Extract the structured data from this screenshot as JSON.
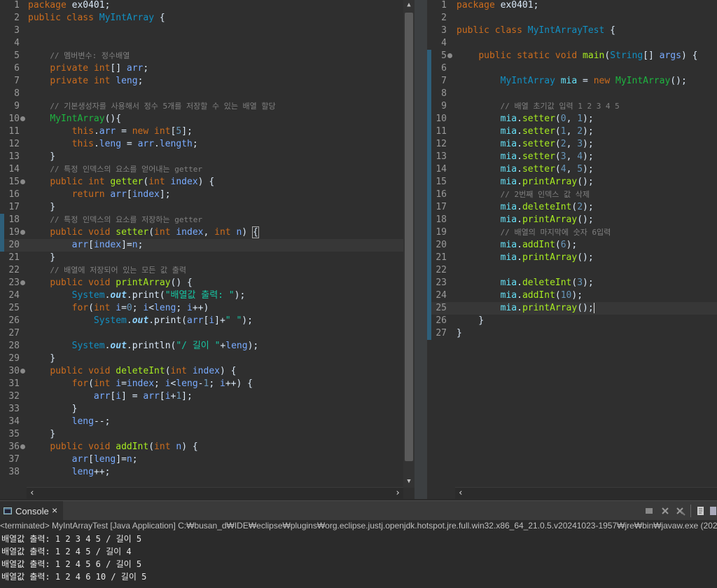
{
  "left_editor": {
    "lines": [
      {
        "n": "1",
        "html": "<span class=\"k\">package</span> ex0401;"
      },
      {
        "n": "2",
        "html": "<span class=\"k\">public</span> <span class=\"k\">class</span> <span class=\"t\">MyIntArray</span> {"
      },
      {
        "n": "3",
        "html": ""
      },
      {
        "n": "4",
        "html": ""
      },
      {
        "n": "5",
        "html": "    <span class=\"c\">// 멤버변수: 정수배열</span>"
      },
      {
        "n": "6",
        "html": "    <span class=\"k\">private</span> <span class=\"k\">int</span>[] <span class=\"v\">arr</span>;"
      },
      {
        "n": "7",
        "html": "    <span class=\"k\">private</span> <span class=\"k\">int</span> <span class=\"v\">leng</span>;"
      },
      {
        "n": "8",
        "html": ""
      },
      {
        "n": "9",
        "html": "    <span class=\"c\">// 기본생성자를 사용해서 정수 5개를 저장할 수 있는 배열 할당</span>"
      },
      {
        "n": "10",
        "fold": true,
        "html": "    <span class=\"f\">MyIntArray</span>(){"
      },
      {
        "n": "11",
        "html": "        <span class=\"k\">this</span>.<span class=\"v\">arr</span> = <span class=\"k\">new</span> <span class=\"k\">int</span>[<span class=\"n\">5</span>];"
      },
      {
        "n": "12",
        "html": "        <span class=\"k\">this</span>.<span class=\"v\">leng</span> = <span class=\"v\">arr</span>.<span class=\"v\">length</span>;"
      },
      {
        "n": "13",
        "html": "    }"
      },
      {
        "n": "14",
        "html": "    <span class=\"c\">// 특정 인덱스의 요소를 얻어내는 getter</span>"
      },
      {
        "n": "15",
        "fold": true,
        "html": "    <span class=\"k\">public</span> <span class=\"k\">int</span> <span class=\"f2\">getter</span>(<span class=\"k\">int</span> <span class=\"v\">index</span>) {"
      },
      {
        "n": "16",
        "html": "        <span class=\"k\">return</span> <span class=\"v\">arr</span>[<span class=\"v\">index</span>];"
      },
      {
        "n": "17",
        "html": "    }"
      },
      {
        "n": "18",
        "html": "    <span class=\"c\">// 특정 인덱스의 요소를 저장하는 getter</span>"
      },
      {
        "n": "19",
        "fold": true,
        "html": "    <span class=\"k\">public</span> <span class=\"k\">void</span> <span class=\"f2\">setter</span>(<span class=\"k\">int</span> <span class=\"v\">index</span>, <span class=\"k\">int</span> <span class=\"v\">n</span>) <span style=\"outline:1px solid #aaa\">{</span>"
      },
      {
        "n": "20",
        "html": "        <span class=\"v\">arr</span>[<span class=\"v\">index</span>]=<span class=\"v\">n</span>;"
      },
      {
        "n": "21",
        "html": "    }"
      },
      {
        "n": "22",
        "html": "    <span class=\"c\">// 배열에 저장되어 있는 모든 값 출력</span>"
      },
      {
        "n": "23",
        "fold": true,
        "html": "    <span class=\"k\">public</span> <span class=\"k\">void</span> <span class=\"f2\">printArray</span>() {"
      },
      {
        "n": "24",
        "html": "        <span class=\"t\">System</span>.<span class=\"st\">out</span>.print(<span class=\"s\">\"배열값 출력: \"</span>);"
      },
      {
        "n": "25",
        "html": "        <span class=\"k\">for</span>(<span class=\"k\">int</span> <span class=\"v\">i</span>=<span class=\"n\">0</span>; <span class=\"v\">i</span>&lt;<span class=\"v\">leng</span>; <span class=\"v\">i</span>++)"
      },
      {
        "n": "26",
        "html": "            <span class=\"t\">System</span>.<span class=\"st\">out</span>.print(<span class=\"v\">arr</span>[<span class=\"v\">i</span>]+<span class=\"s\">\" \"</span>);"
      },
      {
        "n": "27",
        "html": ""
      },
      {
        "n": "28",
        "html": "        <span class=\"t\">System</span>.<span class=\"st\">out</span>.println(<span class=\"s\">\"/ 길이 \"</span>+<span class=\"v\">leng</span>);"
      },
      {
        "n": "29",
        "html": "    }"
      },
      {
        "n": "30",
        "fold": true,
        "html": "    <span class=\"k\">public</span> <span class=\"k\">void</span> <span class=\"f2\">deleteInt</span>(<span class=\"k\">int</span> <span class=\"v\">index</span>) {"
      },
      {
        "n": "31",
        "html": "        <span class=\"k\">for</span>(<span class=\"k\">int</span> <span class=\"v\">i</span>=<span class=\"v\">index</span>; <span class=\"v\">i</span>&lt;<span class=\"v\">leng</span>-<span class=\"n\">1</span>; <span class=\"v\">i</span>++) {"
      },
      {
        "n": "32",
        "html": "            <span class=\"v\">arr</span>[<span class=\"v\">i</span>] = <span class=\"v\">arr</span>[<span class=\"v\">i</span>+<span class=\"n\">1</span>];"
      },
      {
        "n": "33",
        "html": "        }"
      },
      {
        "n": "34",
        "html": "        <span class=\"v\">leng</span>--;"
      },
      {
        "n": "35",
        "html": "    }"
      },
      {
        "n": "36",
        "fold": true,
        "html": "    <span class=\"k\">public</span> <span class=\"k\">void</span> <span class=\"f2\">addInt</span>(<span class=\"k\">int</span> <span class=\"v\">n</span>) {"
      },
      {
        "n": "37",
        "html": "        <span class=\"v\">arr</span>[<span class=\"v\">leng</span>]=<span class=\"v\">n</span>;"
      },
      {
        "n": "38",
        "html": "        <span class=\"v\">leng</span>++;"
      },
      {
        "n": "39",
        "html": "    }"
      }
    ],
    "last_partial_line_number": "39"
  },
  "right_editor": {
    "lines": [
      {
        "n": "1",
        "html": "<span class=\"k\">package</span> ex0401;"
      },
      {
        "n": "2",
        "html": ""
      },
      {
        "n": "3",
        "html": "<span class=\"k\">public</span> <span class=\"k\">class</span> <span class=\"t\">MyIntArrayTest</span> {"
      },
      {
        "n": "4",
        "html": ""
      },
      {
        "n": "5",
        "fold": true,
        "html": "    <span class=\"k\">public</span> <span class=\"k\">static</span> <span class=\"k\">void</span> <span class=\"f2\">main</span>(<span class=\"t\">String</span>[] <span class=\"v\">args</span>) {"
      },
      {
        "n": "6",
        "html": ""
      },
      {
        "n": "7",
        "html": "        <span class=\"t\">MyIntArray</span> <span class=\"fi\">mia</span> = <span class=\"k\">new</span> <span class=\"f\">MyIntArray</span>();"
      },
      {
        "n": "8",
        "html": ""
      },
      {
        "n": "9",
        "html": "        <span class=\"c\">// 배열 초기값 입력 1 2 3 4 5</span>"
      },
      {
        "n": "10",
        "html": "        <span class=\"fi\">mia</span>.<span class=\"f2\">setter</span>(<span class=\"n\">0</span>, <span class=\"n\">1</span>);"
      },
      {
        "n": "11",
        "html": "        <span class=\"fi\">mia</span>.<span class=\"f2\">setter</span>(<span class=\"n\">1</span>, <span class=\"n\">2</span>);"
      },
      {
        "n": "12",
        "html": "        <span class=\"fi\">mia</span>.<span class=\"f2\">setter</span>(<span class=\"n\">2</span>, <span class=\"n\">3</span>);"
      },
      {
        "n": "13",
        "html": "        <span class=\"fi\">mia</span>.<span class=\"f2\">setter</span>(<span class=\"n\">3</span>, <span class=\"n\">4</span>);"
      },
      {
        "n": "14",
        "html": "        <span class=\"fi\">mia</span>.<span class=\"f2\">setter</span>(<span class=\"n\">4</span>, <span class=\"n\">5</span>);"
      },
      {
        "n": "15",
        "html": "        <span class=\"fi\">mia</span>.<span class=\"f2\">printArray</span>();"
      },
      {
        "n": "16",
        "html": "        <span class=\"c\">// 2번째 인덱스 값 삭제</span>"
      },
      {
        "n": "17",
        "html": "        <span class=\"fi\">mia</span>.<span class=\"f2\">deleteInt</span>(<span class=\"n\">2</span>);"
      },
      {
        "n": "18",
        "html": "        <span class=\"fi\">mia</span>.<span class=\"f2\">printArray</span>();"
      },
      {
        "n": "19",
        "html": "        <span class=\"c\">// 배열의 마지막에 숫자 6입력</span>"
      },
      {
        "n": "20",
        "html": "        <span class=\"fi\">mia</span>.<span class=\"f2\">addInt</span>(<span class=\"n\">6</span>);"
      },
      {
        "n": "21",
        "html": "        <span class=\"fi\">mia</span>.<span class=\"f2\">printArray</span>();"
      },
      {
        "n": "22",
        "html": ""
      },
      {
        "n": "23",
        "html": "        <span class=\"fi\">mia</span>.<span class=\"f2\">deleteInt</span>(<span class=\"n\">3</span>);"
      },
      {
        "n": "24",
        "html": "        <span class=\"fi\">mia</span>.<span class=\"f2\">addInt</span>(<span class=\"n\">10</span>);"
      },
      {
        "n": "25",
        "html": "        <span class=\"fi\">mia</span>.<span class=\"f2\">printArray</span>();<span style=\"border-left:1px solid #ddd\"> </span>"
      },
      {
        "n": "26",
        "html": "    }"
      },
      {
        "n": "27",
        "html": "}"
      }
    ]
  },
  "console": {
    "tab_label": "Console",
    "status": "<terminated> MyIntArrayTest [Java Application] C:₩busan_d₩IDE₩eclipse₩plugins₩org.eclipse.justj.openjdk.hotspot.jre.full.win32.x86_64_21.0.5.v20241023-1957₩jre₩bin₩javaw.exe  (2025",
    "output_lines": [
      "배열값 출력: 1 2 3 4 5 / 길이 5",
      "배열값 출력: 1 2 4 5 / 길이 4",
      "배열값 출력: 1 2 4 5 6 / 길이 5",
      "배열값 출력: 1 2 4 6 10 / 길이 5"
    ]
  }
}
